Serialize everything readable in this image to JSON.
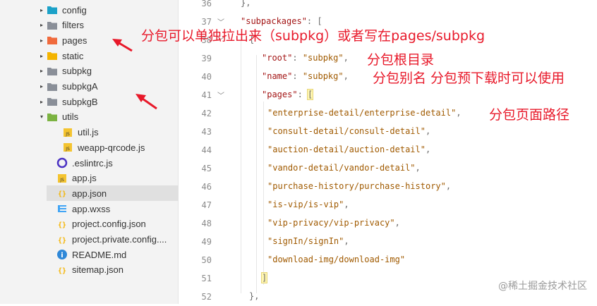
{
  "tree": [
    {
      "label": "config",
      "twisty": "▸",
      "icon": "folder-config-icon",
      "color": "#1ba1c8"
    },
    {
      "label": "filters",
      "twisty": "▸",
      "icon": "folder-icon",
      "color": "#8a8f98"
    },
    {
      "label": "pages",
      "twisty": "▸",
      "icon": "folder-pages-icon",
      "color": "#f06a3c"
    },
    {
      "label": "static",
      "twisty": "▸",
      "icon": "folder-static-icon",
      "color": "#f4b400"
    },
    {
      "label": "subpkg",
      "twisty": "▸",
      "icon": "folder-icon",
      "color": "#8a8f98"
    },
    {
      "label": "subpkgA",
      "twisty": "▸",
      "icon": "folder-icon",
      "color": "#8a8f98"
    },
    {
      "label": "subpkgB",
      "twisty": "▸",
      "icon": "folder-icon",
      "color": "#8a8f98"
    },
    {
      "label": "utils",
      "twisty": "▾",
      "icon": "folder-utils-icon",
      "color": "#7cb342"
    },
    {
      "label": "util.js",
      "twisty": "",
      "icon": "js-file-icon",
      "color": "#f4c430"
    },
    {
      "label": "weapp-qrcode.js",
      "twisty": "",
      "icon": "js-file-icon",
      "color": "#f4c430"
    },
    {
      "label": ".eslintrc.js",
      "twisty": "",
      "icon": "eslint-icon",
      "color": "#4b32c3"
    },
    {
      "label": "app.js",
      "twisty": "",
      "icon": "js-file-icon",
      "color": "#f4c430"
    },
    {
      "label": "app.json",
      "twisty": "",
      "icon": "json-file-icon",
      "color": "#f4b400"
    },
    {
      "label": "app.wxss",
      "twisty": "",
      "icon": "css-file-icon",
      "color": "#42a5f5"
    },
    {
      "label": "project.config.json",
      "twisty": "",
      "icon": "json-file-icon",
      "color": "#f4b400"
    },
    {
      "label": "project.private.config....",
      "twisty": "",
      "icon": "json-file-icon",
      "color": "#f4b400"
    },
    {
      "label": "README.md",
      "twisty": "",
      "icon": "info-icon",
      "color": "#2f88d8"
    },
    {
      "label": "sitemap.json",
      "twisty": "",
      "icon": "json-file-icon",
      "color": "#f4b400"
    }
  ],
  "code_lines": [
    {
      "num": "36",
      "fold": "",
      "parts": [
        {
          "t": "},",
          "c": "p"
        }
      ]
    },
    {
      "num": "37",
      "fold": "﹀",
      "parts": [
        {
          "t": "\"subpackages\"",
          "c": "k"
        },
        {
          "t": ": [",
          "c": "p"
        }
      ]
    },
    {
      "num": "38",
      "fold": "﹀",
      "parts": [
        {
          "t": "{",
          "c": "p"
        }
      ]
    },
    {
      "num": "39",
      "fold": "",
      "parts": [
        {
          "t": "\"root\"",
          "c": "k"
        },
        {
          "t": ": ",
          "c": "p"
        },
        {
          "t": "\"subpkg\"",
          "c": "s"
        },
        {
          "t": ",",
          "c": "p"
        }
      ]
    },
    {
      "num": "40",
      "fold": "",
      "parts": [
        {
          "t": "\"name\"",
          "c": "k"
        },
        {
          "t": ": ",
          "c": "p"
        },
        {
          "t": "\"subpkg\"",
          "c": "s"
        },
        {
          "t": ",",
          "c": "p"
        }
      ]
    },
    {
      "num": "41",
      "fold": "﹀",
      "parts": [
        {
          "t": "\"pages\"",
          "c": "k"
        },
        {
          "t": ": ",
          "c": "p"
        },
        {
          "t": "[",
          "c": "p"
        }
      ]
    },
    {
      "num": "42",
      "fold": "",
      "parts": [
        {
          "t": "\"enterprise-detail/enterprise-detail\"",
          "c": "s"
        },
        {
          "t": ",",
          "c": "p"
        }
      ]
    },
    {
      "num": "43",
      "fold": "",
      "parts": [
        {
          "t": "\"consult-detail/consult-detail\"",
          "c": "s"
        },
        {
          "t": ",",
          "c": "p"
        }
      ]
    },
    {
      "num": "44",
      "fold": "",
      "parts": [
        {
          "t": "\"auction-detail/auction-detail\"",
          "c": "s"
        },
        {
          "t": ",",
          "c": "p"
        }
      ]
    },
    {
      "num": "45",
      "fold": "",
      "parts": [
        {
          "t": "\"vandor-detail/vandor-detail\"",
          "c": "s"
        },
        {
          "t": ",",
          "c": "p"
        }
      ]
    },
    {
      "num": "46",
      "fold": "",
      "parts": [
        {
          "t": "\"purchase-history/purchase-history\"",
          "c": "s"
        },
        {
          "t": ",",
          "c": "p"
        }
      ]
    },
    {
      "num": "47",
      "fold": "",
      "parts": [
        {
          "t": "\"is-vip/is-vip\"",
          "c": "s"
        },
        {
          "t": ",",
          "c": "p"
        }
      ]
    },
    {
      "num": "48",
      "fold": "",
      "parts": [
        {
          "t": "\"vip-privacy/vip-privacy\"",
          "c": "s"
        },
        {
          "t": ",",
          "c": "p"
        }
      ]
    },
    {
      "num": "49",
      "fold": "",
      "parts": [
        {
          "t": "\"signIn/signIn\"",
          "c": "s"
        },
        {
          "t": ",",
          "c": "p"
        }
      ]
    },
    {
      "num": "50",
      "fold": "",
      "parts": [
        {
          "t": "\"download-img/download-img\"",
          "c": "s"
        }
      ]
    },
    {
      "num": "51",
      "fold": "",
      "parts": [
        {
          "t": "]",
          "c": "p"
        }
      ]
    },
    {
      "num": "52",
      "fold": "",
      "parts": [
        {
          "t": "},",
          "c": "p"
        }
      ]
    }
  ],
  "annotations": {
    "subpkg_note": "分包可以单独拉出来（subpkg）或者写在pages/subpkg",
    "root_note": "分包根目录",
    "name_note": "分包别名 分包预下载时可以使用",
    "pages_note": "分包页面路径"
  },
  "watermark": "@稀土掘金技术社区",
  "colors": {
    "annotation": "#e8192a",
    "selected_row": "#e0e0e0"
  }
}
